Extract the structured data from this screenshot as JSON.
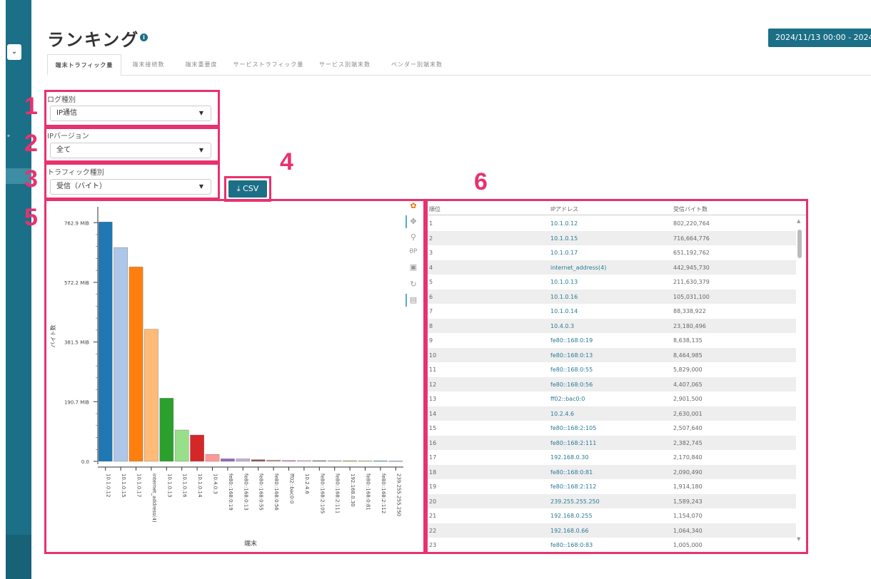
{
  "sidebar": {
    "select_glyph": "⌄",
    "mark": "ﾞ"
  },
  "header": {
    "title": "ランキング",
    "info_icon": "info-icon",
    "date_range": "2024/11/13 00:00 - 2024"
  },
  "tabs": [
    {
      "label": "端末トラフィック量",
      "active": true
    },
    {
      "label": "端末接続数",
      "active": false
    },
    {
      "label": "端末重要度",
      "active": false
    },
    {
      "label": "サービストラフィック量",
      "active": false
    },
    {
      "label": "サービス別端末数",
      "active": false
    },
    {
      "label": "ベンダー別端末数",
      "active": false
    }
  ],
  "filters": {
    "log_type": {
      "label": "ログ種別",
      "value": "IP通信"
    },
    "ip_version": {
      "label": "IPバージョン",
      "value": "全て"
    },
    "traffic_type": {
      "label": "トラフィック種別",
      "value": "受信（バイト）"
    }
  },
  "annotations": [
    "1",
    "2",
    "3",
    "4",
    "5",
    "6"
  ],
  "csv_button": {
    "label": "CSV",
    "icon": "download-icon"
  },
  "chart_data": {
    "type": "bar",
    "xlabel": "端末",
    "ylabel": "バイト数",
    "ytick_labels": [
      "762.9 MiB",
      "572.2 MiB",
      "381.5 MiB",
      "190.7 MiB",
      "0.0"
    ],
    "ytick_values": [
      762.9,
      572.2,
      381.5,
      190.7,
      0
    ],
    "ylim": [
      0,
      800
    ],
    "categories": [
      "10.1.0.12",
      "10.1.0.15",
      "10.1.0.17",
      "internet_address(4)",
      "10.1.0.13",
      "10.1.0.16",
      "10.1.0.14",
      "10.4.0.3",
      "fe80::168:0:19",
      "fe80::168:0:13",
      "fe80::168:0:55",
      "fe80::168:0:56",
      "ff02::bac0:0",
      "10.2.4.6",
      "fe80::168:2:105",
      "fe80::168:2:111",
      "192.168.0.30",
      "fe80::168:0:81",
      "fe80::168:2:112",
      "239.255.255.250"
    ],
    "values": [
      765.1,
      683.5,
      621.3,
      422.4,
      201.9,
      100.2,
      84.3,
      22.1,
      8.2,
      8.1,
      5.5,
      4.2,
      2.8,
      2.5,
      2.4,
      2.3,
      2.1,
      2.0,
      1.8,
      1.5
    ],
    "colors": [
      "#1f77b4",
      "#aec7e8",
      "#ff7f0e",
      "#ffbb78",
      "#2ca02c",
      "#98df8a",
      "#d62728",
      "#ff9896",
      "#9467bd",
      "#c5b0d5",
      "#8c564b",
      "#c49c94",
      "#e377c2",
      "#f7b6d2",
      "#7f7f7f",
      "#c7c7c7",
      "#bcbd22",
      "#dbdb8d",
      "#17becf",
      "#9edae5"
    ],
    "grid": false
  },
  "chart_tools": [
    "bokeh-logo-icon",
    "pan-icon",
    "zoom-icon",
    "zoom-mode-icon",
    "save-icon",
    "reset-icon",
    "hover-icon"
  ],
  "table": {
    "headers": [
      "順位",
      "IPアドレス",
      "受信バイト数"
    ],
    "rows": [
      [
        "1",
        "10.1.0.12",
        "802,220,764"
      ],
      [
        "2",
        "10.1.0.15",
        "716,664,776"
      ],
      [
        "3",
        "10.1.0.17",
        "651,192,762"
      ],
      [
        "4",
        "internet_address(4)",
        "442,945,730"
      ],
      [
        "5",
        "10.1.0.13",
        "211,630,379"
      ],
      [
        "6",
        "10.1.0.16",
        "105,031,100"
      ],
      [
        "7",
        "10.1.0.14",
        "88,338,922"
      ],
      [
        "8",
        "10.4.0.3",
        "23,180,496"
      ],
      [
        "9",
        "fe80::168:0:19",
        "8,638,135"
      ],
      [
        "10",
        "fe80::168:0:13",
        "8,464,985"
      ],
      [
        "11",
        "fe80::168:0:55",
        "5,829,000"
      ],
      [
        "12",
        "fe80::168:0:56",
        "4,407,065"
      ],
      [
        "13",
        "ff02::bac0:0",
        "2,901,500"
      ],
      [
        "14",
        "10.2.4.6",
        "2,630,001"
      ],
      [
        "15",
        "fe80::168:2:105",
        "2,507,640"
      ],
      [
        "16",
        "fe80::168:2:111",
        "2,382,745"
      ],
      [
        "17",
        "192.168.0.30",
        "2,170,840"
      ],
      [
        "18",
        "fe80::168:0:81",
        "2,090,490"
      ],
      [
        "19",
        "fe80::168:2:112",
        "1,914,180"
      ],
      [
        "20",
        "239.255.255.250",
        "1,589,243"
      ],
      [
        "21",
        "192.168.0.255",
        "1,154,070"
      ],
      [
        "22",
        "192.168.0.66",
        "1,064,340"
      ],
      [
        "23",
        "fe80::168:0:83",
        "1,005,000"
      ]
    ]
  }
}
